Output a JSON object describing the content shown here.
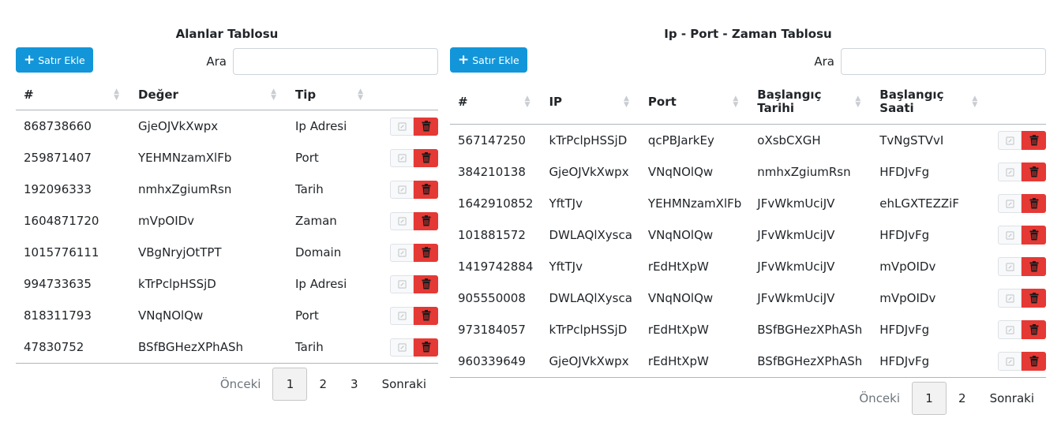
{
  "left": {
    "title": "Alanlar Tablosu",
    "add_label": "Satır Ekle",
    "search_label": "Ara",
    "search_value": "",
    "columns": [
      "#",
      "Değer",
      "Tip"
    ],
    "rows": [
      [
        "868738660",
        "GjeOJVkXwpx",
        "Ip Adresi"
      ],
      [
        "259871407",
        "YEHMNzamXlFb",
        "Port"
      ],
      [
        "192096333",
        "nmhxZgiumRsn",
        "Tarih"
      ],
      [
        "1604871720",
        "mVpOIDv",
        "Zaman"
      ],
      [
        "1015776111",
        "VBgNryjOtTPT",
        "Domain"
      ],
      [
        "994733635",
        "kTrPclpHSSjD",
        "Ip Adresi"
      ],
      [
        "818311793",
        "VNqNOlQw",
        "Port"
      ],
      [
        "47830752",
        "BSfBGHezXPhASh",
        "Tarih"
      ]
    ],
    "pager": {
      "prev": "Önceki",
      "pages": [
        "1",
        "2",
        "3"
      ],
      "next": "Sonraki",
      "current": "1"
    }
  },
  "right": {
    "title": "Ip - Port - Zaman Tablosu",
    "add_label": "Satır Ekle",
    "search_label": "Ara",
    "search_value": "",
    "columns": [
      "#",
      "IP",
      "Port",
      "Başlangıç\nTarihi",
      "Başlangıç\nSaati"
    ],
    "rows": [
      [
        "567147250",
        "kTrPclpHSSjD",
        "qcPBJarkEy",
        "oXsbCXGH",
        "TvNgSTVvI"
      ],
      [
        "384210138",
        "GjeOJVkXwpx",
        "VNqNOlQw",
        "nmhxZgiumRsn",
        "HFDJvFg"
      ],
      [
        "1642910852",
        "YftTJv",
        "YEHMNzamXlFb",
        "JFvWkmUciJV",
        "ehLGXTEZZiF"
      ],
      [
        "101881572",
        "DWLAQlXysca",
        "VNqNOlQw",
        "JFvWkmUciJV",
        "HFDJvFg"
      ],
      [
        "1419742884",
        "YftTJv",
        "rEdHtXpW",
        "JFvWkmUciJV",
        "mVpOIDv"
      ],
      [
        "905550008",
        "DWLAQlXysca",
        "VNqNOlQw",
        "JFvWkmUciJV",
        "mVpOIDv"
      ],
      [
        "973184057",
        "kTrPclpHSSjD",
        "rEdHtXpW",
        "BSfBGHezXPhASh",
        "HFDJvFg"
      ],
      [
        "960339649",
        "GjeOJVkXwpx",
        "rEdHtXpW",
        "BSfBGHezXPhASh",
        "HFDJvFg"
      ]
    ],
    "pager": {
      "prev": "Önceki",
      "pages": [
        "1",
        "2"
      ],
      "next": "Sonraki",
      "current": "1"
    }
  },
  "icons": {
    "add": "plus-icon",
    "edit": "pencil-icon",
    "delete": "trash-icon",
    "sort": "sort-icon"
  },
  "colors": {
    "primary": "#1296d9",
    "danger": "#e53935"
  }
}
